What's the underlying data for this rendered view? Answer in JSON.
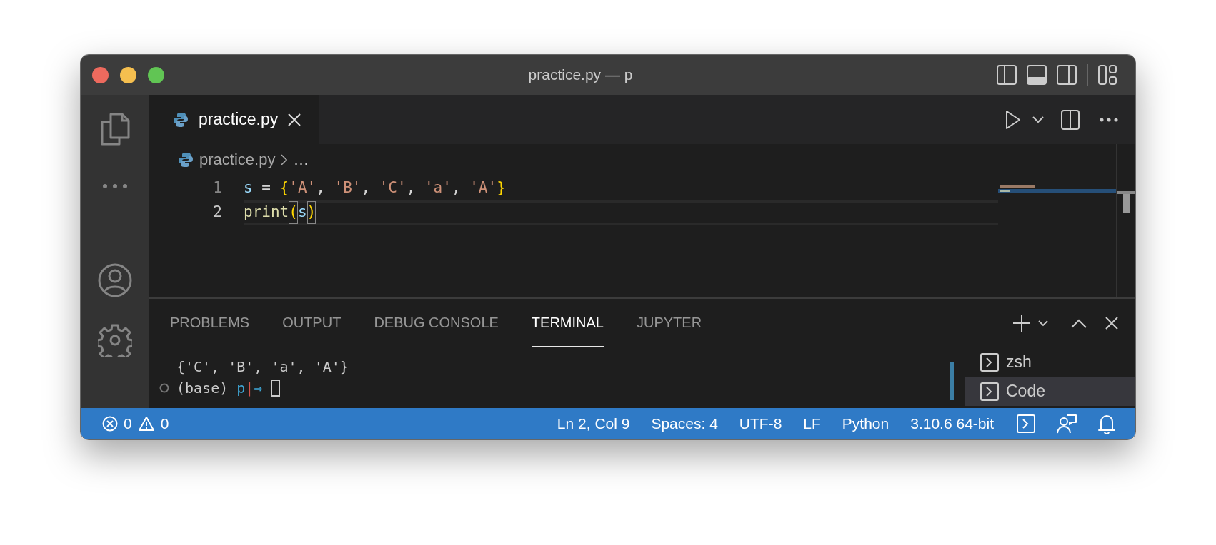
{
  "window": {
    "title": "practice.py — p"
  },
  "tabs": [
    {
      "label": "practice.py",
      "selected": true
    }
  ],
  "breadcrumb": [
    "practice.py",
    "…"
  ],
  "code_lines": [
    {
      "number": "1",
      "current": false,
      "tokens": [
        {
          "text": "s",
          "kind": "variable"
        },
        {
          "text": " = ",
          "kind": "operator"
        },
        {
          "text": "{",
          "kind": "brace"
        },
        {
          "text": "'A'",
          "kind": "string"
        },
        {
          "text": ", ",
          "kind": "operator"
        },
        {
          "text": "'B'",
          "kind": "string"
        },
        {
          "text": ", ",
          "kind": "operator"
        },
        {
          "text": "'C'",
          "kind": "string"
        },
        {
          "text": ", ",
          "kind": "operator"
        },
        {
          "text": "'a'",
          "kind": "string"
        },
        {
          "text": ", ",
          "kind": "operator"
        },
        {
          "text": "'A'",
          "kind": "string"
        },
        {
          "text": "}",
          "kind": "brace"
        }
      ]
    },
    {
      "number": "2",
      "current": true,
      "tokens": [
        {
          "text": "print",
          "kind": "function"
        },
        {
          "text": "(",
          "kind": "matched_bracket"
        },
        {
          "text": "s",
          "kind": "variable"
        },
        {
          "text": ")",
          "kind": "matched_bracket"
        }
      ]
    }
  ],
  "panel_tabs": [
    {
      "label": "PROBLEMS",
      "selected": false
    },
    {
      "label": "OUTPUT",
      "selected": false
    },
    {
      "label": "DEBUG CONSOLE",
      "selected": false
    },
    {
      "label": "TERMINAL",
      "selected": true
    },
    {
      "label": "JUPYTER",
      "selected": false
    }
  ],
  "terminal": {
    "output": "{'C', 'B', 'a', 'A'}",
    "prompt": [
      {
        "text": "(base) ",
        "kind": "plain"
      },
      {
        "text": "p",
        "kind": "accent"
      },
      {
        "text": "|",
        "kind": "separator"
      },
      {
        "text": "⇒",
        "kind": "accent"
      }
    ]
  },
  "terminals": [
    {
      "name": "zsh",
      "selected": false
    },
    {
      "name": "Code",
      "selected": true
    }
  ],
  "status_bar": {
    "errors": "0",
    "warnings": "0",
    "items": [
      "Ln 2, Col 9",
      "Spaces: 4",
      "UTF-8",
      "LF",
      "Python",
      "3.10.6 64-bit"
    ]
  }
}
